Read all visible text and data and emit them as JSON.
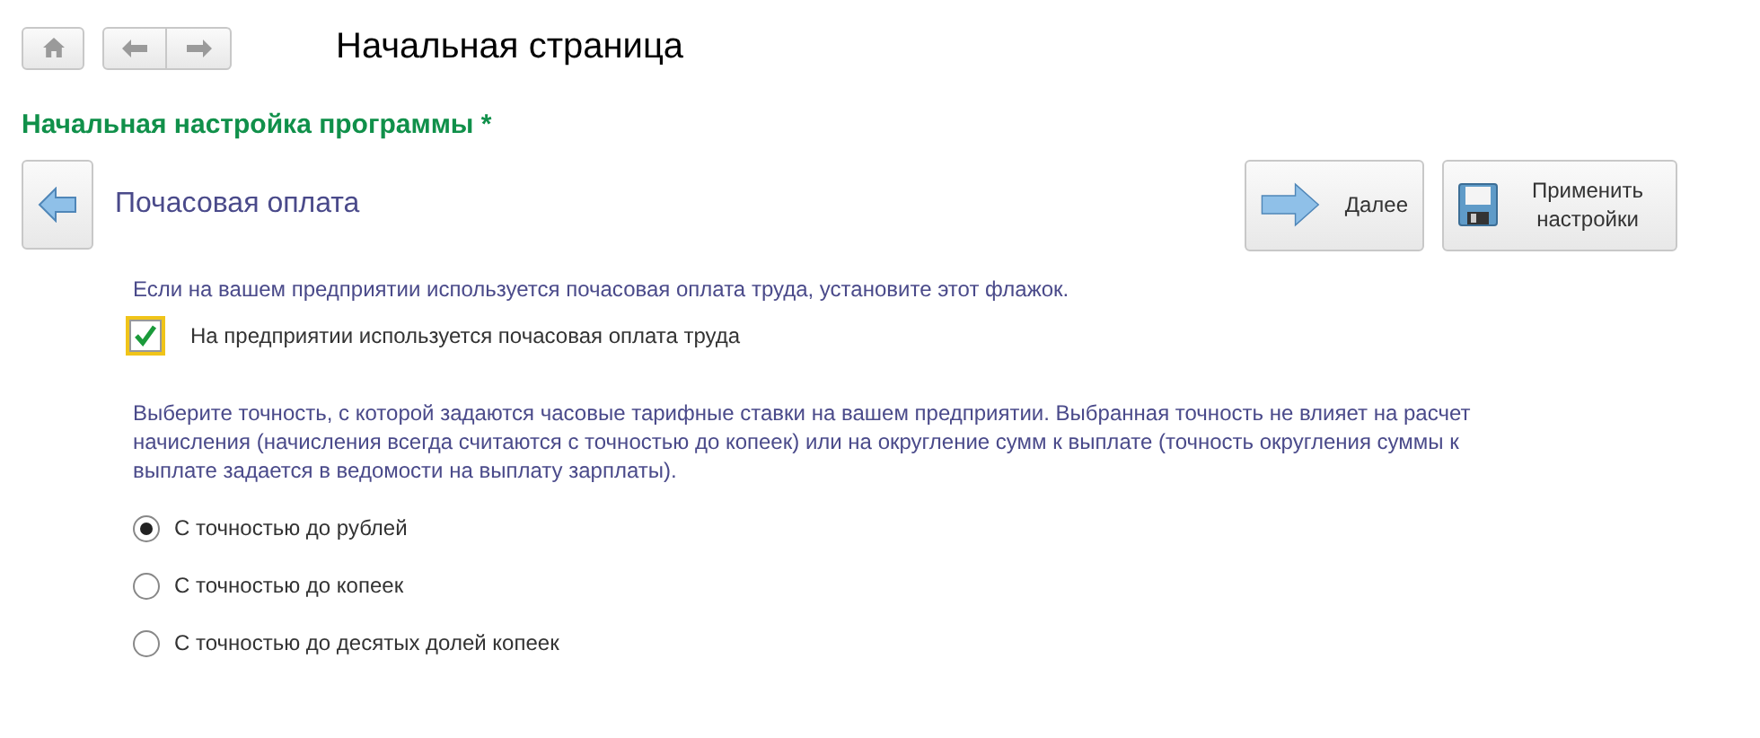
{
  "window": {
    "title": "Начальная страница"
  },
  "form": {
    "title": "Начальная настройка программы *"
  },
  "step": {
    "title": "Почасовая оплата"
  },
  "buttons": [
    {
      "kind": "next",
      "label": "Далее"
    },
    {
      "kind": "save",
      "label": "Применить настройки"
    }
  ],
  "hint": "Если на вашем предприятии используется почасовая оплата труда, установите этот флажок.",
  "checkbox": {
    "label": "На предприятии используется почасовая оплата труда",
    "checked": true
  },
  "description": "Выберите точность, с которой задаются часовые тарифные ставки на вашем предприятии. Выбранная точность не влияет на расчет начисления (начисления всегда считаются с точностью до копеек) или на округление сумм к выплате (точность округления суммы к выплате задается в ведомости на выплату зарплаты).",
  "options": [
    {
      "label": "С точностью до рублей",
      "selected": true
    },
    {
      "label": "С точностью до копеек",
      "selected": false
    },
    {
      "label": "С точностью до десятых долей копеек",
      "selected": false
    }
  ]
}
